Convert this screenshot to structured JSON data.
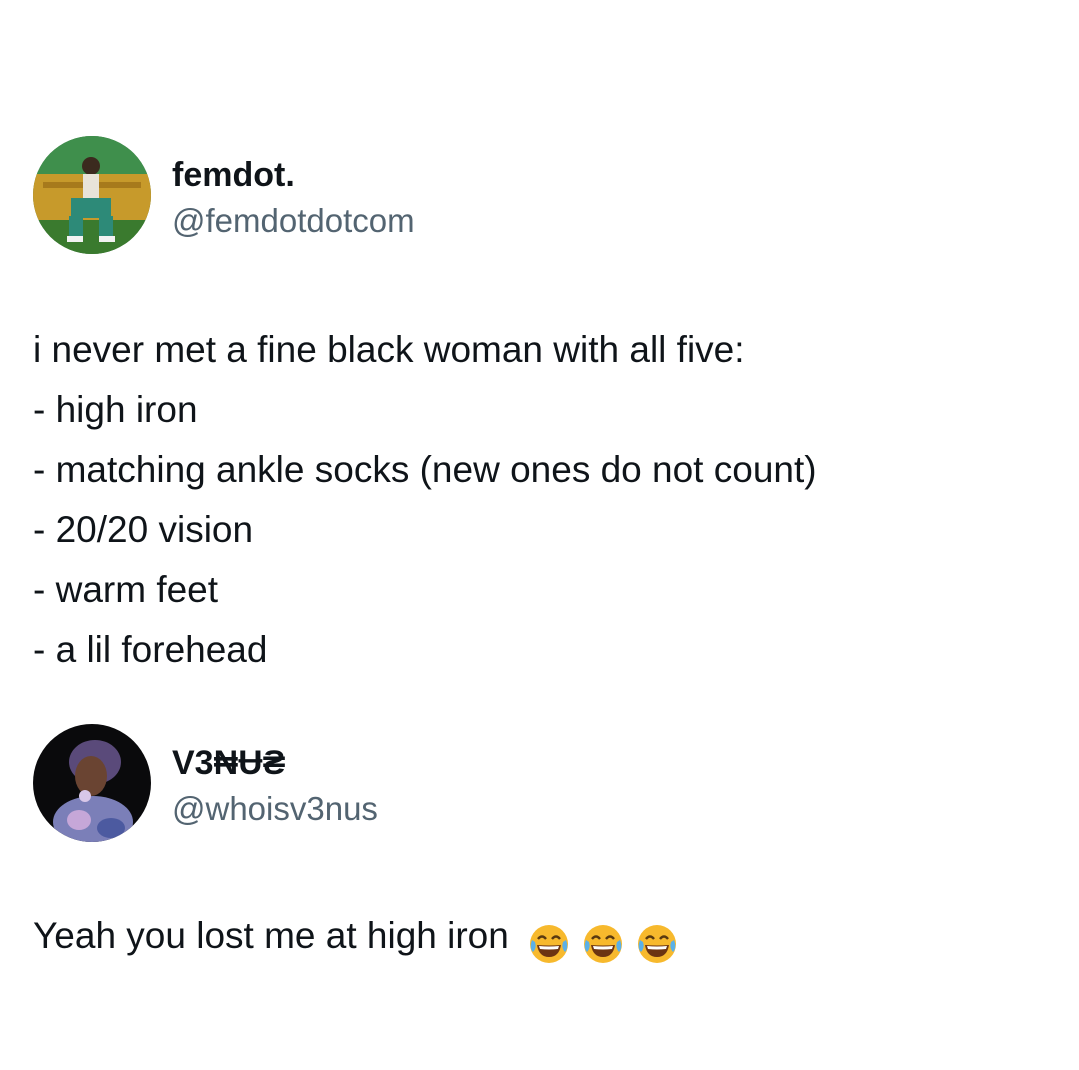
{
  "tweets": [
    {
      "display_name": "femdot.",
      "handle": "@femdotdotcom",
      "lines": [
        "i never met a fine black woman with all five:",
        "- high iron",
        "- matching ankle socks (new ones do not count)",
        "- 20/20 vision",
        "- warm feet",
        "- a lil forehead"
      ]
    },
    {
      "display_name": "V3₦Ʉ₴",
      "handle": "@whoisv3nus",
      "text": "Yeah you lost me at high iron",
      "emojis": [
        "face-with-tears-of-joy-icon",
        "face-with-tears-of-joy-icon",
        "face-with-tears-of-joy-icon"
      ]
    }
  ],
  "colors": {
    "text": "#0f1419",
    "handle": "#536471",
    "emoji_face": "#f7b92d",
    "emoji_tears": "#5ab0e8"
  }
}
